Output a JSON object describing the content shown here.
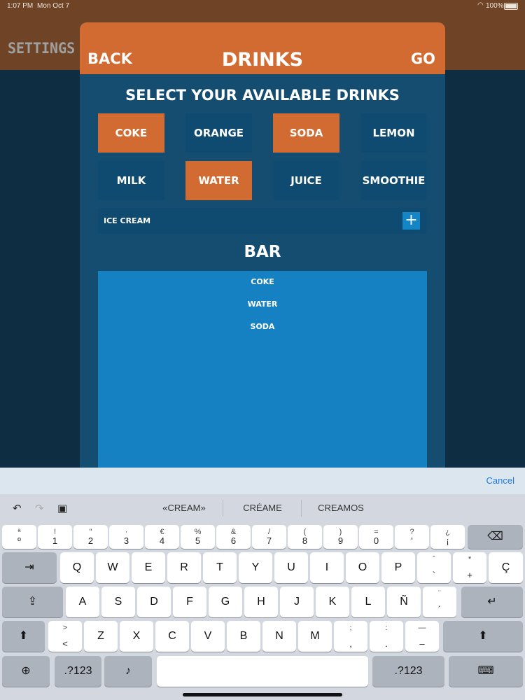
{
  "status": {
    "time": "1:07 PM",
    "date": "Mon Oct 7",
    "battery": "100%"
  },
  "background": {
    "title": "SETTINGS"
  },
  "modal": {
    "back": "BACK",
    "title": "DRINKS",
    "go": "GO",
    "select_title": "SELECT YOUR AVAILABLE DRINKS",
    "drinks": [
      {
        "label": "COKE",
        "selected": true
      },
      {
        "label": "ORANGE",
        "selected": false
      },
      {
        "label": "SODA",
        "selected": true
      },
      {
        "label": "LEMON",
        "selected": false
      },
      {
        "label": "MILK",
        "selected": false
      },
      {
        "label": "WATER",
        "selected": true
      },
      {
        "label": "JUICE",
        "selected": false
      },
      {
        "label": "SMOOTHIE",
        "selected": false
      }
    ],
    "new_drink_value": "ICE CREAM",
    "add_label": "+",
    "bar_title": "BAR",
    "bar_items": [
      "COKE",
      "WATER",
      "SODA"
    ]
  },
  "keyboard": {
    "cancel": "Cancel",
    "suggestions": [
      "«CREAM»",
      "CRÉAME",
      "CREAMOS"
    ],
    "row1": [
      {
        "top": "ª",
        "bot": "º"
      },
      {
        "top": "!",
        "bot": "1"
      },
      {
        "top": "\"",
        "bot": "2"
      },
      {
        "top": "·",
        "bot": "3"
      },
      {
        "top": "€",
        "bot": "4"
      },
      {
        "top": "%",
        "bot": "5"
      },
      {
        "top": "&",
        "bot": "6"
      },
      {
        "top": "/",
        "bot": "7"
      },
      {
        "top": "(",
        "bot": "8"
      },
      {
        "top": ")",
        "bot": "9"
      },
      {
        "top": "=",
        "bot": "0"
      },
      {
        "top": "?",
        "bot": "'"
      },
      {
        "top": "¿",
        "bot": "¡"
      }
    ],
    "row2": [
      "Q",
      "W",
      "E",
      "R",
      "T",
      "Y",
      "U",
      "I",
      "O",
      "P"
    ],
    "row2_extra": [
      {
        "top": "ˆ",
        "bot": "`"
      },
      {
        "top": "*",
        "bot": "+"
      }
    ],
    "row2_last": "Ç",
    "row3": [
      "A",
      "S",
      "D",
      "F",
      "G",
      "H",
      "J",
      "K",
      "L",
      "Ñ"
    ],
    "row3_extra": {
      "top": "¨",
      "bot": "´"
    },
    "row4_first": {
      "top": ">",
      "bot": "<"
    },
    "row4": [
      "Z",
      "X",
      "C",
      "V",
      "B",
      "N",
      "M"
    ],
    "row4_extra": [
      {
        "top": ";",
        "bot": ","
      },
      {
        "top": ":",
        "bot": "."
      },
      {
        "top": "—",
        "bot": "–"
      }
    ],
    "numbers_label": ".?123"
  }
}
